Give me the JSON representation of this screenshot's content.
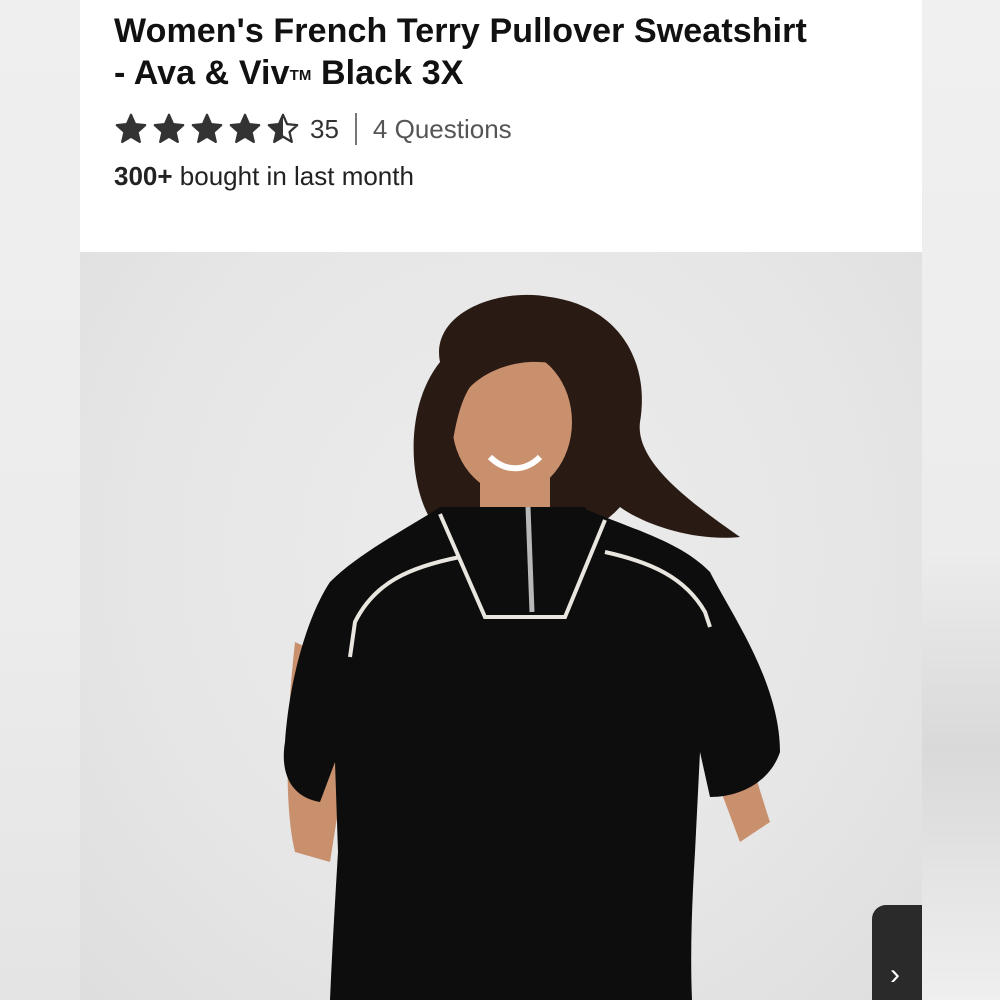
{
  "product": {
    "title_line1": "Women's French Terry Pullover Sweatshirt",
    "title_line2_prefix": "- Ava & Viv",
    "title_trademark": "TM",
    "title_line2_suffix": " Black 3X",
    "rating": 4.5,
    "rating_max": 5,
    "review_count": "35",
    "questions_label": "4 Questions",
    "bought_count": "300+",
    "bought_text": " bought in last month"
  },
  "colors": {
    "star": "#333333",
    "garment": "#0d0d0d",
    "piping": "#e8e6df",
    "hair": "#2a1a14",
    "skin": "#c9906e",
    "background": "#e6e6e6"
  },
  "image": {
    "alt": "model wearing black pullover sweatshirt",
    "nav_icon": "chevron-right-icon"
  }
}
